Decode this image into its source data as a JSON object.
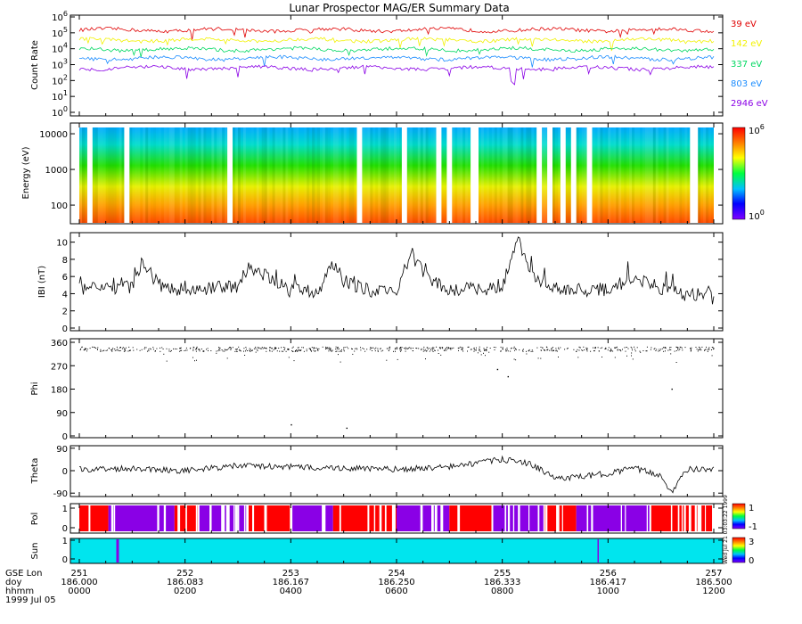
{
  "title": "Lunar Prospector MAG/ER Summary Data",
  "stamp": "Wed Jul 21 03:03:22 1999",
  "date_label": "1999 Jul 05",
  "axis_rows": {
    "labels": [
      "GSE Lon",
      "doy",
      "hhmm"
    ],
    "gse_lon": [
      "251",
      "252",
      "253",
      "254",
      "255",
      "256",
      "257"
    ],
    "doy": [
      "186.000",
      "186.083",
      "186.167",
      "186.250",
      "186.333",
      "186.417",
      "186.500"
    ],
    "hhmm": [
      "0000",
      "0200",
      "0400",
      "0600",
      "0800",
      "1000",
      "1200"
    ]
  },
  "colors": {
    "e39": "#e00000",
    "e142": "#f2f200",
    "e337": "#00d860",
    "e803": "#1a8cff",
    "e2946": "#8a00e6",
    "sun": "#00e5ee",
    "shadow": "#8a00e6",
    "pol_pos": "#ff0000",
    "pol_neg": "#8a00e6"
  },
  "chart_data": [
    {
      "type": "line",
      "name": "count-rate",
      "ylabel": "Count Rate",
      "yscale": "log",
      "yticks": [
        "10^0",
        "10^1",
        "10^2",
        "10^3",
        "10^4",
        "10^5",
        "10^6"
      ],
      "ylim": [
        1,
        1000000
      ],
      "xlim": [
        0,
        12
      ],
      "series": [
        {
          "name": "39 eV",
          "level": 150000
        },
        {
          "name": "142 eV",
          "level": 35000
        },
        {
          "name": "337 eV",
          "level": 9000
        },
        {
          "name": "803 eV",
          "level": 2500
        },
        {
          "name": "2946 eV",
          "level": 600
        }
      ]
    },
    {
      "type": "heatmap",
      "name": "energy-spectrogram",
      "ylabel": "Energy (eV)",
      "yscale": "log",
      "yticks": [
        "100",
        "1000",
        "10000"
      ],
      "ylim": [
        40,
        15000
      ],
      "colorbar_ticks": [
        "10^6",
        "10^0"
      ],
      "data_gaps_hours": [
        [
          0.15,
          0.25
        ],
        [
          0.85,
          0.95
        ],
        [
          2.8,
          2.9
        ],
        [
          5.25,
          5.35
        ],
        [
          6.1,
          6.2
        ],
        [
          6.75,
          6.85
        ],
        [
          6.95,
          7.05
        ],
        [
          7.4,
          7.55
        ],
        [
          8.65,
          8.75
        ],
        [
          8.85,
          8.95
        ],
        [
          9.1,
          9.2
        ],
        [
          9.3,
          9.4
        ],
        [
          9.6,
          9.7
        ],
        [
          11.55,
          11.7
        ]
      ]
    },
    {
      "type": "line",
      "name": "b-magnitude",
      "ylabel": "IBI (nT)",
      "yticks": [
        "0",
        "2",
        "4",
        "6",
        "8",
        "10"
      ],
      "ylim": [
        0,
        11
      ],
      "xlim": [
        0,
        12
      ],
      "points": [
        [
          0,
          4.5
        ],
        [
          1,
          4.8
        ],
        [
          1.2,
          7.8
        ],
        [
          1.5,
          5.0
        ],
        [
          2,
          4.4
        ],
        [
          3,
          4.9
        ],
        [
          3.2,
          7.2
        ],
        [
          4,
          4.5
        ],
        [
          4.5,
          4.2
        ],
        [
          4.8,
          7.5
        ],
        [
          5,
          5.5
        ],
        [
          5.5,
          4.3
        ],
        [
          6,
          4.4
        ],
        [
          6.3,
          8.8
        ],
        [
          6.6,
          5.6
        ],
        [
          7,
          4.5
        ],
        [
          8,
          4.6
        ],
        [
          8.3,
          10.4
        ],
        [
          8.6,
          5.8
        ],
        [
          9,
          4.5
        ],
        [
          10,
          4.4
        ],
        [
          10.5,
          6.0
        ],
        [
          11,
          4.6
        ],
        [
          11.5,
          3.8
        ],
        [
          12,
          4.2
        ]
      ]
    },
    {
      "type": "scatter",
      "name": "phi",
      "ylabel": "Phi",
      "yticks": [
        "0",
        "90",
        "180",
        "270",
        "360"
      ],
      "ylim": [
        0,
        360
      ],
      "xlim": [
        0,
        12
      ],
      "base_level": 335,
      "outliers": [
        [
          5.05,
          32
        ],
        [
          4.0,
          45
        ],
        [
          11.2,
          182
        ],
        [
          8.1,
          230
        ],
        [
          7.9,
          258
        ]
      ]
    },
    {
      "type": "line",
      "name": "theta",
      "ylabel": "Theta",
      "yticks": [
        "-90",
        "0",
        "90"
      ],
      "ylim": [
        -100,
        100
      ],
      "xlim": [
        0,
        12
      ],
      "points": [
        [
          0,
          5
        ],
        [
          1,
          10
        ],
        [
          2,
          0
        ],
        [
          3,
          20
        ],
        [
          4,
          15
        ],
        [
          5,
          10
        ],
        [
          6,
          5
        ],
        [
          7,
          15
        ],
        [
          8,
          45
        ],
        [
          8.5,
          30
        ],
        [
          9,
          -30
        ],
        [
          9.5,
          -25
        ],
        [
          10,
          -10
        ],
        [
          10.5,
          10
        ],
        [
          11,
          -20
        ],
        [
          11.2,
          -85
        ],
        [
          11.5,
          5
        ],
        [
          12,
          5
        ]
      ]
    },
    {
      "type": "heatmap",
      "name": "polarity",
      "ylabel": "Pol",
      "yticks": [
        "0",
        "1"
      ],
      "colorbar_ticks": [
        "1",
        "-1"
      ],
      "segments": [
        [
          0,
          0.55,
          1
        ],
        [
          0.55,
          1.8,
          -1
        ],
        [
          1.8,
          2.25,
          1
        ],
        [
          2.25,
          3.2,
          -1
        ],
        [
          3.2,
          4.0,
          1
        ],
        [
          4.0,
          4.8,
          -1
        ],
        [
          4.8,
          6.0,
          1
        ],
        [
          6.0,
          7.0,
          -1
        ],
        [
          7.0,
          7.8,
          1
        ],
        [
          7.8,
          8.8,
          -1
        ],
        [
          8.8,
          9.4,
          1
        ],
        [
          9.4,
          10.8,
          -1
        ],
        [
          10.8,
          12.0,
          1
        ]
      ]
    },
    {
      "type": "heatmap",
      "name": "sun",
      "ylabel": "Sun",
      "yticks": [
        "0",
        "1"
      ],
      "colorbar_ticks": [
        "3",
        "0"
      ],
      "shadow_hours": [
        0.7,
        9.8
      ]
    }
  ],
  "legend_labels": [
    "39 eV",
    "142 eV",
    "337 eV",
    "803 eV",
    "2946 eV"
  ]
}
